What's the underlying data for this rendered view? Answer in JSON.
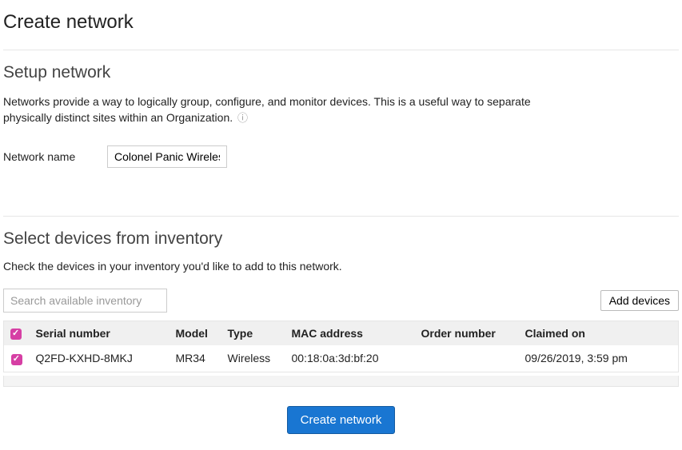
{
  "page": {
    "title": "Create network"
  },
  "setup": {
    "heading": "Setup network",
    "description": "Networks provide a way to logically group, configure, and monitor devices. This is a useful way to separate physically distinct sites within an Organization.",
    "name_label": "Network name",
    "name_value": "Colonel Panic Wireless"
  },
  "inventory": {
    "heading": "Select devices from inventory",
    "description": "Check the devices in your inventory you'd like to add to this network.",
    "search_placeholder": "Search available inventory",
    "add_devices_label": "Add devices",
    "columns": {
      "serial": "Serial number",
      "model": "Model",
      "type": "Type",
      "mac": "MAC address",
      "order": "Order number",
      "claimed": "Claimed on"
    },
    "rows": [
      {
        "checked": true,
        "serial": "Q2FD-KXHD-8MKJ",
        "model": "MR34",
        "type": "Wireless",
        "mac": "00:18:0a:3d:bf:20",
        "order": "",
        "claimed": "09/26/2019, 3:59 pm"
      }
    ]
  },
  "actions": {
    "create_label": "Create network"
  }
}
